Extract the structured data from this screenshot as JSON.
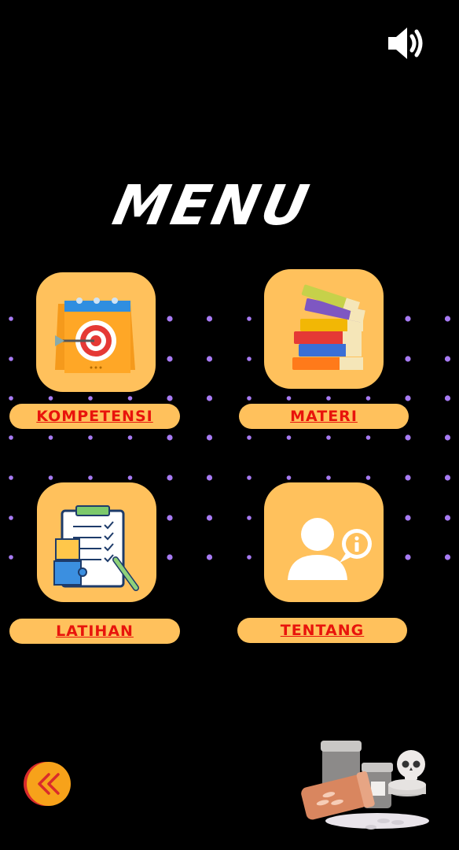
{
  "header": {
    "title": "MENU",
    "sound_icon": "speaker-volume-icon"
  },
  "menu": {
    "items": [
      {
        "label": "KOMPETENSI",
        "icon": "target-calendar-icon"
      },
      {
        "label": "MATERI",
        "icon": "books-stack-icon"
      },
      {
        "label": "LATIHAN",
        "icon": "checklist-clipboard-icon"
      },
      {
        "label": "TENTANG",
        "icon": "user-info-icon"
      }
    ]
  },
  "footer": {
    "back_icon": "double-chevron-left-icon",
    "decoration": "medicine-bottles-skull-icon"
  },
  "colors": {
    "background": "#000000",
    "tile": "#ffc15c",
    "label_text": "#e8140c",
    "dot": "#a77bf3",
    "back_button": "#f7a21a"
  }
}
